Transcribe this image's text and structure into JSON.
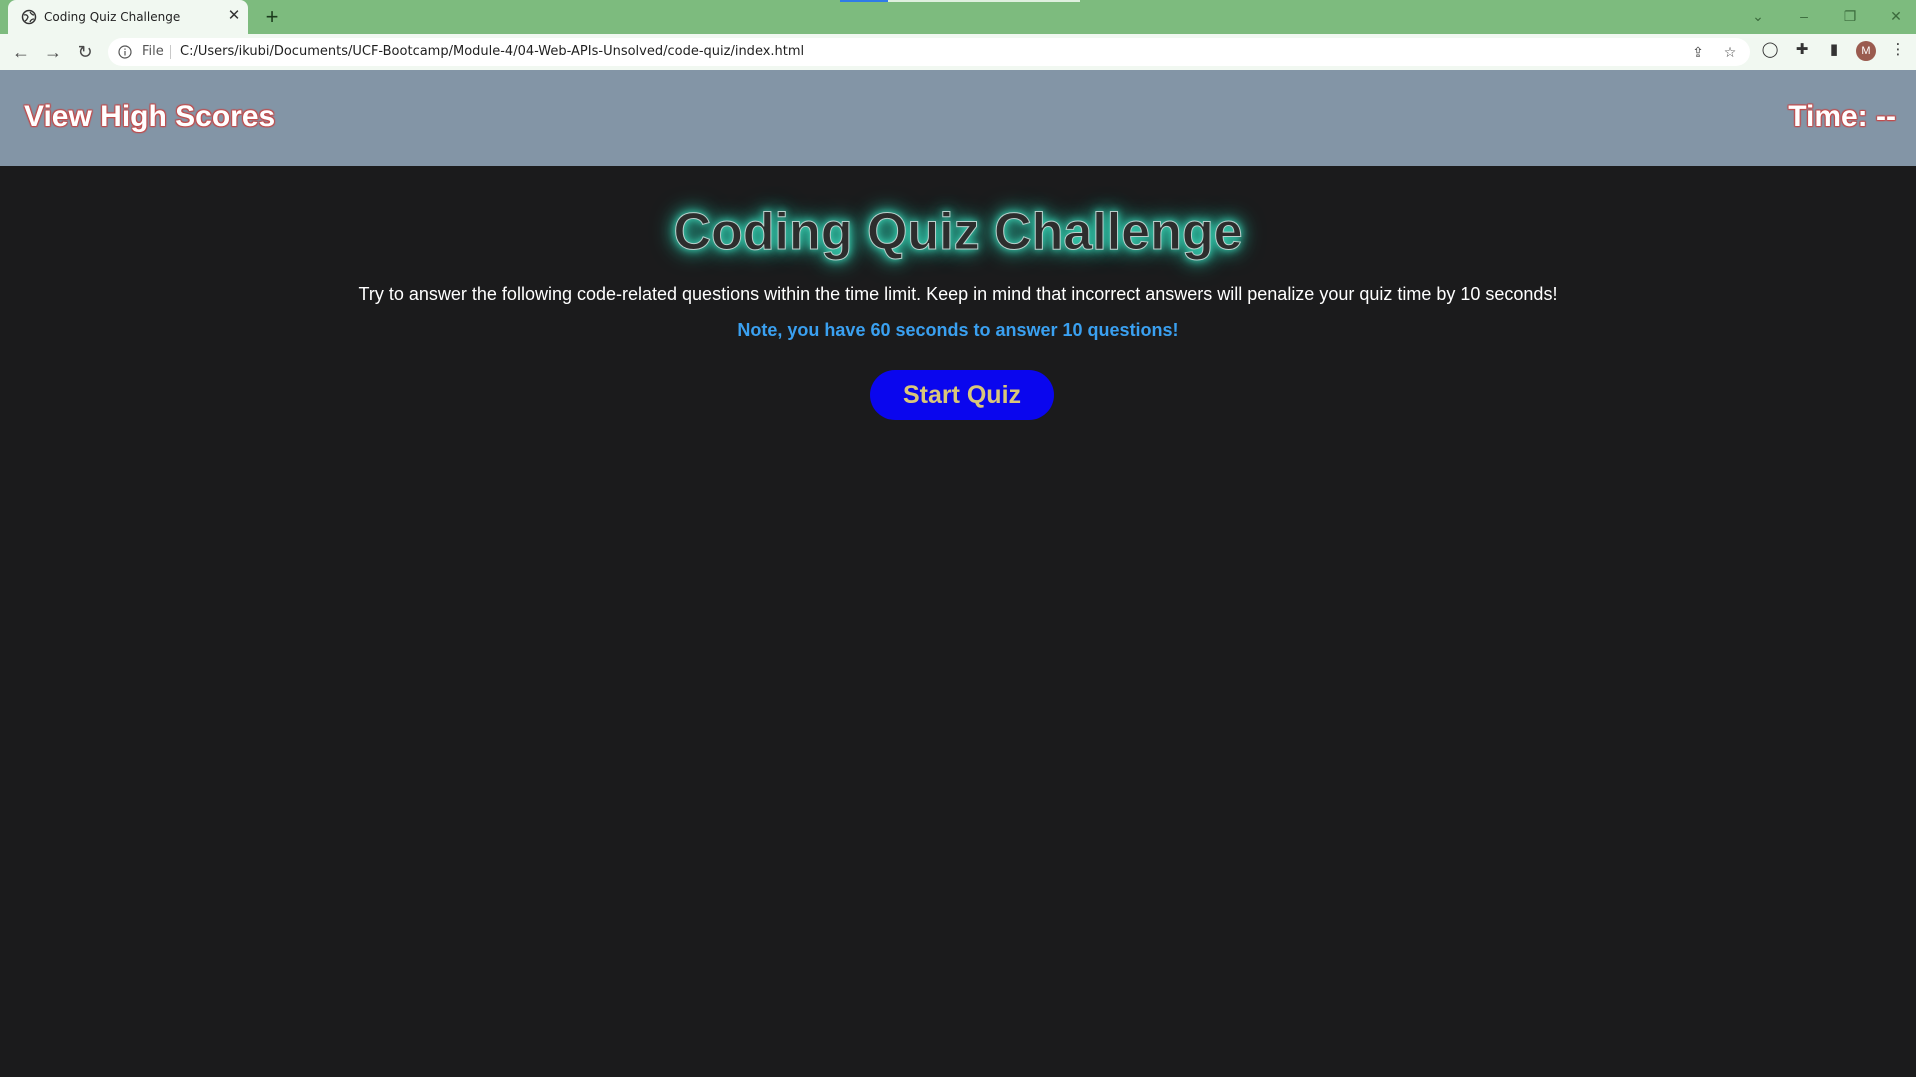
{
  "browser": {
    "tab_title": "Coding Quiz Challenge",
    "tab_close": "✕",
    "new_tab": "+",
    "file_label": "File",
    "url": "C:/Users/ikubi/Documents/UCF-Bootcamp/Module-4/04-Web-APIs-Unsolved/code-quiz/index.html",
    "avatar_letter": "M",
    "page_load_progress": 0.2,
    "icons": {
      "back": "back-arrow-icon",
      "forward": "forward-arrow-icon",
      "reload": "reload-icon",
      "info": "info-icon",
      "share": "share-icon",
      "bookmark": "star-icon",
      "extension_a": "circle-icon",
      "extensions": "puzzle-icon",
      "side_panel": "side-panel-icon",
      "menu": "kebab-menu-icon"
    },
    "colors": {
      "tabstrip": "#7dbb7e",
      "toolbar": "#f1f8f1"
    }
  },
  "header": {
    "high_scores_label": "View High Scores",
    "timer_text": "Time: --"
  },
  "quiz": {
    "title": "Coding Quiz Challenge",
    "instructions": "Try to answer the following code-related questions within the time limit. Keep in mind that incorrect answers will penalize your quiz time by 10 seconds!",
    "note": "Note, you have 60 seconds to answer 10 questions!",
    "start_label": "Start Quiz"
  },
  "colors": {
    "page_bg": "#1b1b1c",
    "header_bg": "#8395a6",
    "note_text": "#3aa0f0",
    "start_button_bg": "#0a06ee",
    "start_button_text": "#d9c67a",
    "title_glow": "#40e0c0"
  }
}
